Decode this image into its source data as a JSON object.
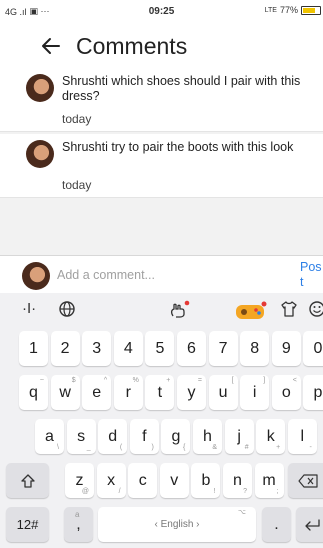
{
  "status_bar": {
    "left": "4G .ıl",
    "time": "09:25",
    "network": "LTE",
    "battery": "77%",
    "battery_level": 0.77,
    "battery_color": "#f0c400"
  },
  "header": {
    "back_icon": "arrow-left-icon",
    "title": "Comments"
  },
  "comments": [
    {
      "text": "Shrushti which shoes should I pair with this dress?",
      "time": "today"
    },
    {
      "text": "Shrushti try to pair the boots with this look",
      "time": "today"
    }
  ],
  "composer": {
    "placeholder": "Add a comment...",
    "post_label": "Post"
  },
  "colors": {
    "accent": "#2d7fe6",
    "sticker_dot": "#e53935"
  },
  "keyboard": {
    "toolbar_icons": [
      "text-cursor-icon",
      "globe-icon",
      "hand-icon",
      "game-pad-icon",
      "shirt-icon",
      "emoji-icon"
    ],
    "row_numbers": [
      "1",
      "2",
      "3",
      "4",
      "5",
      "6",
      "7",
      "8",
      "9",
      "0"
    ],
    "row_q": [
      {
        "key": "q",
        "alt": "~"
      },
      {
        "key": "w",
        "alt": "$"
      },
      {
        "key": "e",
        "alt": "^"
      },
      {
        "key": "r",
        "alt": "%"
      },
      {
        "key": "t",
        "alt": "+"
      },
      {
        "key": "y",
        "alt": "="
      },
      {
        "key": "u",
        "alt": "["
      },
      {
        "key": "i",
        "alt": "]"
      },
      {
        "key": "o",
        "alt": "<"
      },
      {
        "key": "p",
        "alt": ">"
      }
    ],
    "row_a": [
      {
        "key": "a",
        "alt": "\\"
      },
      {
        "key": "s",
        "alt": "_"
      },
      {
        "key": "d",
        "alt": "("
      },
      {
        "key": "f",
        "alt": ")"
      },
      {
        "key": "g",
        "alt": "{"
      },
      {
        "key": "h",
        "alt": "&"
      },
      {
        "key": "j",
        "alt": "#"
      },
      {
        "key": "k",
        "alt": "+"
      },
      {
        "key": "l",
        "alt": "-"
      }
    ],
    "row_z": [
      {
        "key": "z",
        "alt": "@"
      },
      {
        "key": "x",
        "alt": "/"
      },
      {
        "key": "c",
        "alt": ""
      },
      {
        "key": "v",
        "alt": ""
      },
      {
        "key": "b",
        "alt": "!"
      },
      {
        "key": "n",
        "alt": "?"
      },
      {
        "key": "m",
        "alt": ";"
      }
    ],
    "shift_icon": "shift-icon",
    "backspace_icon": "backspace-icon",
    "symbols_label": "12#",
    "comma_label": ",",
    "comma_alt": "a",
    "space_label": "English",
    "space_alt": "⌥",
    "period_label": ".",
    "enter_icon": "enter-icon"
  }
}
